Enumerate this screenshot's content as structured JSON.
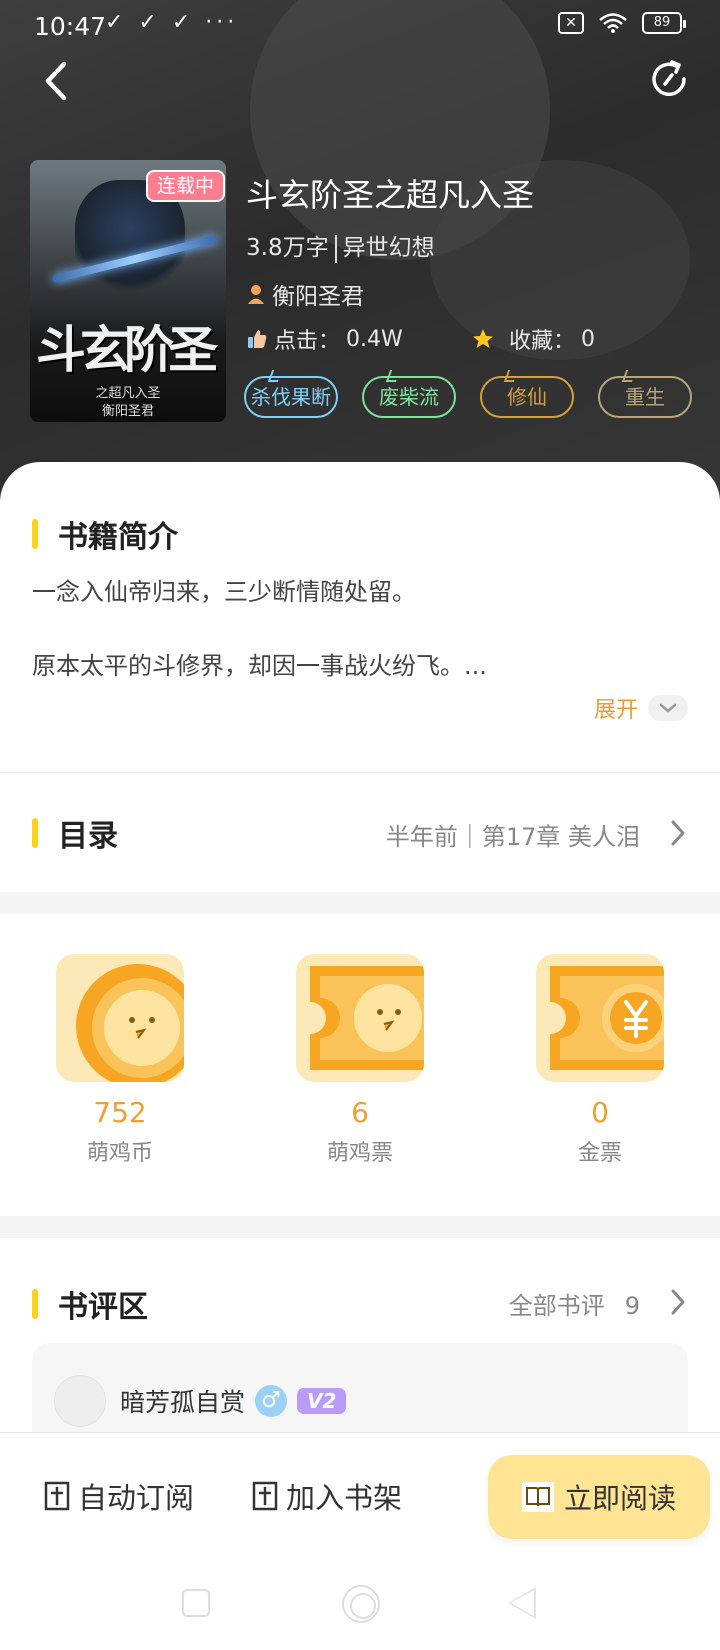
{
  "status_bar": {
    "time": "10:47",
    "notif_icons": "✓ ✓ ✓ ···",
    "battery": "89"
  },
  "book": {
    "status_badge": "连载中",
    "title": "斗玄阶圣之超凡入圣",
    "word_count": "3.8万字",
    "genre": "异世幻想",
    "author": "衡阳圣君",
    "clicks_label": "点击：",
    "clicks_value": "0.4W",
    "favorites_label": "收藏：",
    "favorites_value": "0",
    "tags": [
      {
        "label": "杀伐果断",
        "color": "#7fd0f5"
      },
      {
        "label": "废柴流",
        "color": "#7fe29a"
      },
      {
        "label": "修仙",
        "color": "#d4a03a"
      },
      {
        "label": "重生",
        "color": "#b6a77a"
      }
    ],
    "cover": {
      "title_art": "斗玄阶圣",
      "subtitle": "之超凡入圣",
      "author": "衡阳圣君"
    }
  },
  "intro": {
    "title": "书籍简介",
    "line1": "一念入仙帝归来，三少断情随处留。",
    "line2": "原本太平的斗修界，却因一事战火纷飞。...",
    "expand_label": "展开"
  },
  "toc": {
    "title": "目录",
    "latest": "半年前｜第17章 美人泪"
  },
  "wallet": [
    {
      "value": "752",
      "label": "萌鸡币"
    },
    {
      "value": "6",
      "label": "萌鸡票"
    },
    {
      "value": "0",
      "label": "金票"
    }
  ],
  "reviews": {
    "title": "书评区",
    "all_label": "全部书评",
    "count": "9",
    "first_user": {
      "name": "暗芳孤自赏",
      "gender_symbol": "♂",
      "vip": "V2"
    }
  },
  "bottom_bar": {
    "auto_subscribe": "自动订阅",
    "add_shelf": "加入书架",
    "read_now": "立即阅读"
  },
  "colors": {
    "accent": "#ffd11a",
    "orange": "#ee9b2f",
    "read_button": "#ffe593"
  }
}
